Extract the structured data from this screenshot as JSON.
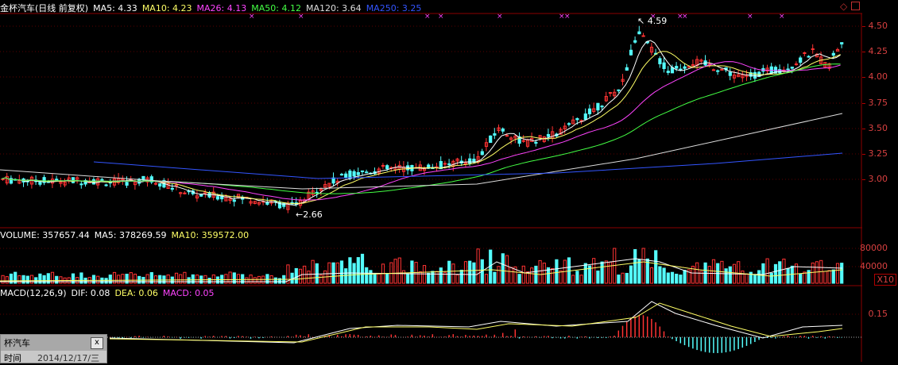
{
  "header": {
    "title": "金杯汽车(日线 前复权)",
    "ma": [
      {
        "label": "MA5: 4.33",
        "color": "#ffffff"
      },
      {
        "label": "MA10: 4.23",
        "color": "#ffff66"
      },
      {
        "label": "MA26: 4.13",
        "color": "#ff44ff"
      },
      {
        "label": "MA50: 4.12",
        "color": "#44ff44"
      },
      {
        "label": "MA120: 3.64",
        "color": "#dddddd"
      },
      {
        "label": "MA250: 3.25",
        "color": "#3355ff"
      }
    ]
  },
  "price_axis": [
    "4.50",
    "4.25",
    "4.00",
    "3.75",
    "3.50",
    "3.25",
    "3.00"
  ],
  "annotations": {
    "high": "4.59",
    "low": "2.66"
  },
  "volume": {
    "header": [
      {
        "label": "VOLUME: 357657.44",
        "color": "#ffffff"
      },
      {
        "label": "MA5: 378269.59",
        "color": "#ffffff"
      },
      {
        "label": "MA10: 359572.00",
        "color": "#ffff66"
      }
    ],
    "axis": [
      "80000",
      "40000"
    ],
    "unit": "X10"
  },
  "macd": {
    "header": [
      {
        "label": "MACD(12,26,9)",
        "color": "#ffffff"
      },
      {
        "label": "DIF: 0.08",
        "color": "#ffffff"
      },
      {
        "label": "DEA: 0.06",
        "color": "#ffff66"
      },
      {
        "label": "MACD: 0.05",
        "color": "#ff44ff"
      }
    ],
    "axis": [
      "0.15"
    ]
  },
  "float_window": {
    "title": "杯汽车",
    "close": "x",
    "row_label": "时间",
    "row_value": "2014/12/17/三"
  },
  "colors": {
    "up": "#ff3333",
    "down": "#54fcfc",
    "background": "#000000",
    "axis_text": "#d84040"
  }
}
